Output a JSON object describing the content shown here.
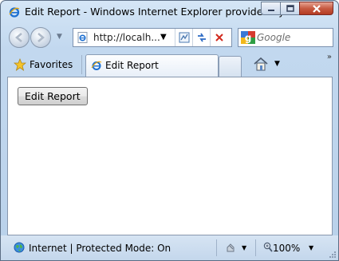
{
  "window": {
    "title": "Edit Report - Windows Internet Explorer provided by ...",
    "caption_buttons": [
      "minimize",
      "maximize",
      "close"
    ]
  },
  "navigation": {
    "back_icon": "back-arrow-icon",
    "forward_icon": "forward-arrow-icon",
    "address": {
      "value": "http://localh...",
      "page_icon": "ie-page-icon"
    },
    "address_buttons": [
      "compatibility-view-icon",
      "refresh-icon",
      "stop-icon"
    ],
    "search": {
      "placeholder": "Google",
      "provider_icon": "google-icon"
    }
  },
  "tabs": {
    "favorites_label": "Favorites",
    "active_tab_label": "Edit Report",
    "more_symbol": "»"
  },
  "content": {
    "edit_button_label": "Edit Report"
  },
  "status": {
    "zone_text": "Internet | Protected Mode: On",
    "zoom": "100%"
  },
  "colors": {
    "chrome": "#c2d8ef",
    "close_button": "#c75b42",
    "content_bg": "#ffffff"
  }
}
